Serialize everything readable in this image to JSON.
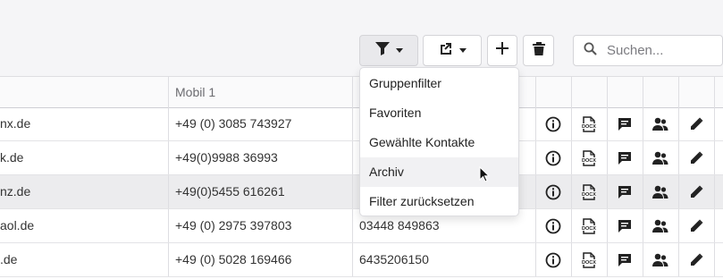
{
  "search": {
    "placeholder": "Suchen..."
  },
  "table": {
    "headers": {
      "col1": "",
      "mobile1": "Mobil 1"
    },
    "rows": [
      {
        "email": "nx.de",
        "mobile1": "+49 (0) 3085 743927",
        "col3": ""
      },
      {
        "email": "k.de",
        "mobile1": "+49(0)9988 36993",
        "col3": ""
      },
      {
        "email": "nz.de",
        "mobile1": "+49(0)5455 616261",
        "col3": ""
      },
      {
        "email": "aol.de",
        "mobile1": "+49 (0) 2975 397803",
        "col3": "03448 849863"
      },
      {
        "email": ".de",
        "mobile1": "+49 (0) 5028 169466",
        "col3": "6435206150"
      }
    ],
    "row_icons": [
      "info-icon",
      "docx-icon",
      "comment-icon",
      "contacts-icon",
      "edit-icon"
    ]
  },
  "filter_menu": {
    "items": [
      "Gruppenfilter",
      "Favoriten",
      "Gewählte Kontakte",
      "Archiv",
      "Filter zurücksetzen"
    ],
    "hovered": "Archiv"
  }
}
